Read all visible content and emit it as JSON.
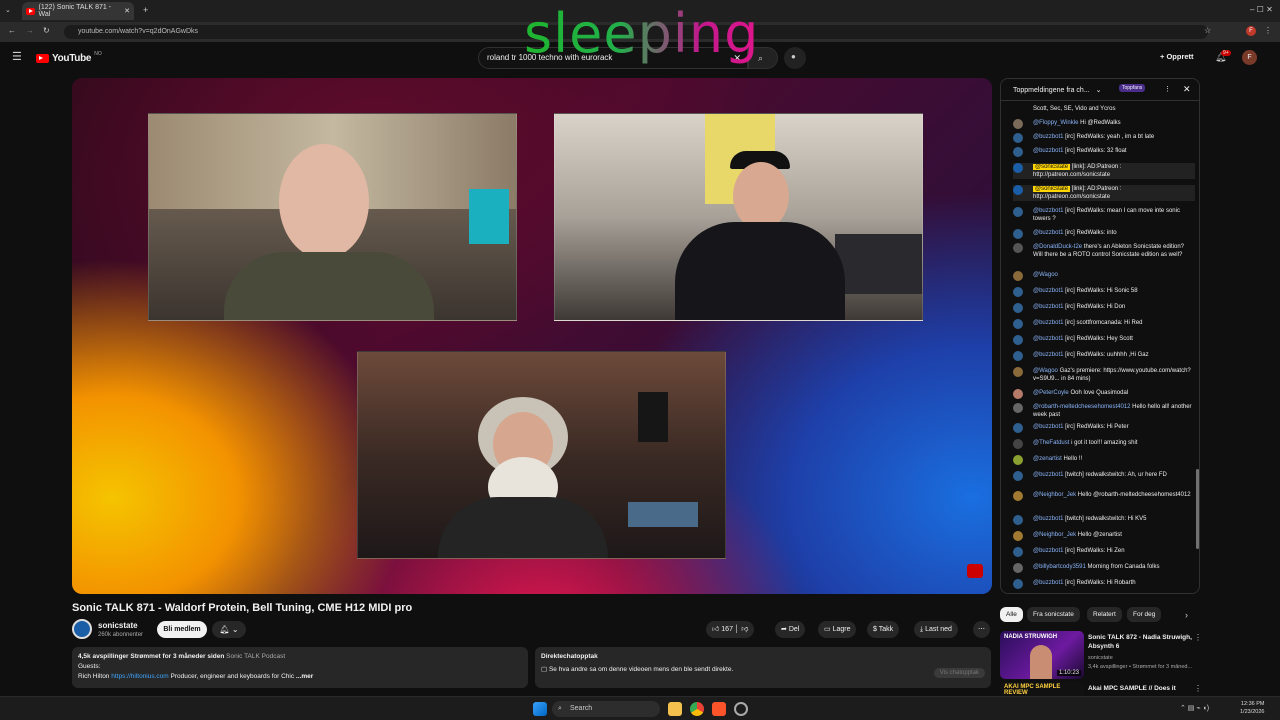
{
  "browser": {
    "tab_title": "(122) Sonic TALK 871 - Wal",
    "url": "youtube.com/watch?v=q2dOnAGwDks"
  },
  "youtube": {
    "logo_text": "YouTube",
    "country_code": "NO",
    "search_value": "roland tr 1000 techno with eurorack",
    "create_label": "Opprett",
    "notif_count": "9+",
    "profile_initial": "F"
  },
  "overlay": {
    "text": "sleeping"
  },
  "video": {
    "title": "Sonic TALK 871 - Waldorf Protein, Bell Tuning, CME H12 MIDI pro",
    "channel": "sonicstate",
    "subscribers": "260k abonnenter",
    "join_label": "Bli medlem",
    "likes": "167",
    "share_label": "Del",
    "save_label": "Lagre",
    "thanks_label": "Takk",
    "download_label": "Last ned"
  },
  "description": {
    "stats": "4,5k avspillinger  Strømmet for 3 måneder siden",
    "playlist": "Sonic TALK Podcast",
    "guests_label": "Guests:",
    "guest_name": "Rich Hilton",
    "guest_link": "https://hiltonius.com",
    "guest_desc": "Producer, engineer and keyboards for Chic",
    "more": "...mer"
  },
  "chat_replay": {
    "title": "Direktechatopptak",
    "text": "Se hva andre sa om denne videoen mens den ble sendt direkte.",
    "button": "Vis chatopptak"
  },
  "chat": {
    "header": "Toppmeldingene fra ch...",
    "toppfans": "Toppfans",
    "messages": [
      {
        "author": "",
        "text": "Scott, Sec, SE, Vido and Ycros"
      },
      {
        "author": "@Floppy_Winkle",
        "text": "Hi @RedWalks"
      },
      {
        "author": "@buzzbot1",
        "text": "[irc] RedWalks: yeah , im a bt late"
      },
      {
        "author": "@buzzbot1",
        "text": "[irc] RedWalks: 32 float"
      },
      {
        "author": "@sonicstate",
        "text": "[link]: AD:Patreon : http://patreon.com/sonicstate"
      },
      {
        "author": "@sonicstate",
        "text": "[link]: AD:Patreon : http://patreon.com/sonicstate"
      },
      {
        "author": "@buzzbot1",
        "text": "[irc] RedWalks: mean I can move inte sonic towers ?"
      },
      {
        "author": "@buzzbot1",
        "text": "[irc] RedWalks: into"
      },
      {
        "author": "@DonaldDuck-t2e",
        "text": "there's an Ableton Sonicstate edition? Will there be a ROTO control Sonicstate edition as well?"
      },
      {
        "author": "@Wagoo",
        "text": ""
      },
      {
        "author": "@buzzbot1",
        "text": "[irc] RedWalks: Hi Sonic 58"
      },
      {
        "author": "@buzzbot1",
        "text": "[irc] RedWalks: Hi Don"
      },
      {
        "author": "@buzzbot1",
        "text": "[irc] scottfromcanada: Hi Red"
      },
      {
        "author": "@buzzbot1",
        "text": "[irc] RedWalks: Hey Scott"
      },
      {
        "author": "@buzzbot1",
        "text": "[irc] RedWalks: uuhhhh ,Hi Gaz"
      },
      {
        "author": "@Wagoo",
        "text": "Gaz's premiere: https://www.youtube.com/watch?v=S9U9... in 84 mins)"
      },
      {
        "author": "@PeterCoyle",
        "text": "Ooh love Quasimodal"
      },
      {
        "author": "@robarth-meltedcheesehomest4012",
        "text": "Hello hello all! another week past"
      },
      {
        "author": "@buzzbot1",
        "text": "[irc] RedWalks: Hi Peter"
      },
      {
        "author": "@TheFatdust",
        "text": "i got it too!!! amazing shit"
      },
      {
        "author": "@zenartist",
        "text": "Hello !!"
      },
      {
        "author": "@buzzbot1",
        "text": "[twitch] redwalkstwitch: Ah, ur here FD"
      },
      {
        "author": "@Neighbor_Jek",
        "text": "Hello @robarth-meltedcheesehomest4012"
      },
      {
        "author": "@buzzbot1",
        "text": "[twitch] redwalkstwitch: Hi KV5"
      },
      {
        "author": "@Neighbor_Jek",
        "text": "Hello @zenartist"
      },
      {
        "author": "@buzzbot1",
        "text": "[irc] RedWalks: Hi Zen"
      },
      {
        "author": "@billybartcody3591",
        "text": "Morning from Canada folks"
      },
      {
        "author": "@buzzbot1",
        "text": "[irc] RedWalks: Hi Robarth"
      }
    ]
  },
  "chips": [
    "Alle",
    "Fra sonicstate",
    "Relatert",
    "For deg"
  ],
  "recommendations": [
    {
      "thumb_text": "NADIA STRUWIGH",
      "duration": "1:10:23",
      "title": "Sonic TALK 872 - Nadia Struwigh, Absynth 6",
      "channel": "sonicstate",
      "meta": "3,4k avspillinger • Strømmet for 3 måned..."
    },
    {
      "thumb_text": "AKAI MPC SAMPLE  REVIEW",
      "duration": "",
      "title": "Akai MPC SAMPLE // Does it",
      "channel": "",
      "meta": ""
    }
  ],
  "taskbar": {
    "search_label": "Search",
    "time": "12:36 PM",
    "date": "1/23/2026"
  },
  "colors": {
    "accent": "#ff0000",
    "link": "#3ea6ff",
    "owner_badge": "#ffd600"
  }
}
